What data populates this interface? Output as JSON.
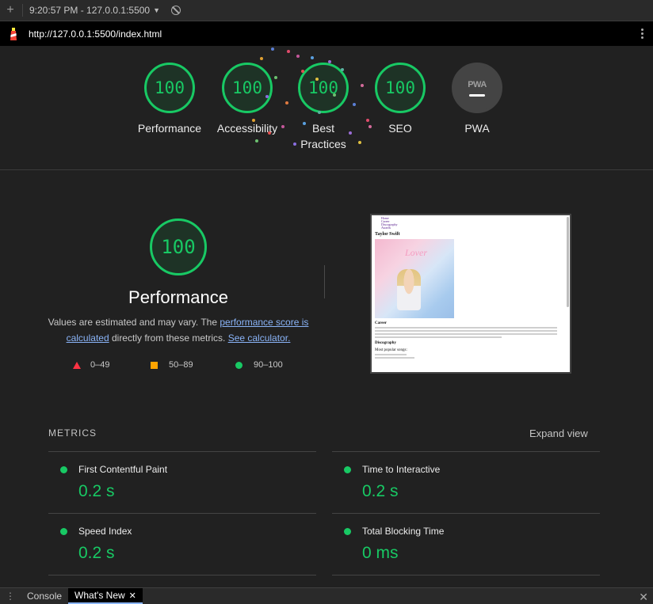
{
  "topbar": {
    "time_url": "9:20:57 PM - 127.0.0.1:5500"
  },
  "urlbar": {
    "url": "http://127.0.0.1:5500/index.html"
  },
  "scores": [
    {
      "label": "Performance",
      "value": "100"
    },
    {
      "label": "Accessibility",
      "value": "100"
    },
    {
      "label": "Best Practices",
      "value": "100"
    },
    {
      "label": "SEO",
      "value": "100"
    },
    {
      "label": "PWA",
      "badge": "PWA"
    }
  ],
  "performance": {
    "score": "100",
    "title": "Performance",
    "desc_start": "Values are estimated and may vary. The ",
    "link_score": "performance score is calculated",
    "desc_mid": " directly from these metrics. ",
    "link_calc": "See calculator."
  },
  "legend": {
    "fail": "0–49",
    "average": "50–89",
    "pass": "90–100"
  },
  "thumbnail": {
    "nav_items": [
      "Home",
      "Career",
      "Discography",
      "Awards"
    ],
    "heading": "Taylor Swift",
    "image_word": "Lover",
    "section1": "Career",
    "section2": "Discography",
    "section3": "Most popular songs:"
  },
  "metrics": {
    "header": "METRICS",
    "expand_label": "Expand view",
    "items": [
      {
        "name": "First Contentful Paint",
        "value": "0.2 s"
      },
      {
        "name": "Time to Interactive",
        "value": "0.2 s"
      },
      {
        "name": "Speed Index",
        "value": "0.2 s"
      },
      {
        "name": "Total Blocking Time",
        "value": "0 ms"
      }
    ]
  },
  "drawer": {
    "tab_console": "Console",
    "tab_whats_new": "What's New"
  },
  "colors": {
    "pass": "#18c964",
    "average": "#ffa400",
    "fail": "#ff3344",
    "link": "#8ab4f8"
  }
}
